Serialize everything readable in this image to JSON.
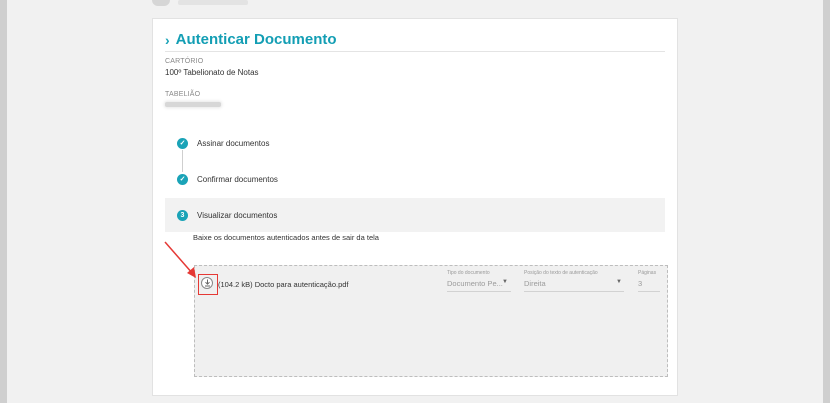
{
  "page": {
    "title": "Autenticar Documento",
    "title_icon": "chevron-right-icon",
    "accent_color": "#1aa3b7",
    "highlight_color": "#e53935"
  },
  "fields": {
    "cartorio_label": "CARTÓRIO",
    "cartorio_value": "100º Tabelionato de Notas",
    "tabeliao_label": "TABELIÃO"
  },
  "steps": [
    {
      "label": "Assinar documentos",
      "status": "done",
      "icon": "check-icon",
      "number": "✓"
    },
    {
      "label": "Confirmar documentos",
      "status": "done",
      "icon": "check-icon",
      "number": "✓"
    },
    {
      "label": "Visualizar documentos",
      "status": "active",
      "number": "3"
    }
  ],
  "instruction": "Baixe os documentos autenticados antes de sair da tela",
  "document": {
    "size": "(104.2 kB)",
    "filename": "Docto para autenticação.pdf",
    "download_icon": "download-icon",
    "tipo_label": "Tipo do documento",
    "tipo_value": "Documento Pe...",
    "posicao_label": "Posição do texto de autenticação",
    "posicao_value": "Direita",
    "paginas_label": "Páginas",
    "paginas_value": "3"
  }
}
